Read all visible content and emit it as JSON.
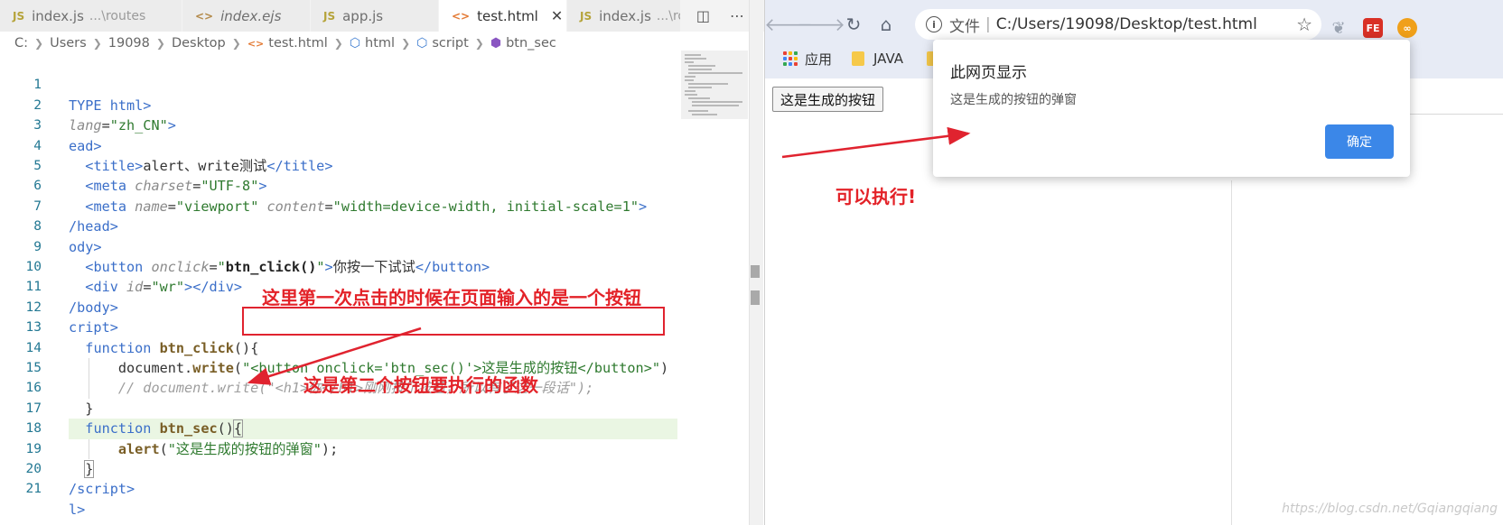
{
  "editor": {
    "tabs": [
      {
        "icon": "JS",
        "name": "index.js",
        "path": "...\\routes",
        "type": "js",
        "italic": false
      },
      {
        "icon": "<>",
        "name": "index.ejs",
        "path": "",
        "type": "ejs",
        "italic": true
      },
      {
        "icon": "JS",
        "name": "app.js",
        "path": "",
        "type": "js",
        "italic": false
      },
      {
        "icon": "<>",
        "name": "test.html",
        "path": "",
        "type": "html",
        "italic": false,
        "active": true,
        "close": "✕"
      },
      {
        "icon": "JS",
        "name": "index.js",
        "path": "...\\rou",
        "type": "js",
        "italic": false
      }
    ],
    "breadcrumb": [
      "C:",
      "Users",
      "19098",
      "Desktop",
      "test.html",
      "html",
      "script",
      "btn_sec"
    ],
    "tab_actions": [
      "◫",
      "⋯"
    ]
  },
  "code_lines": {
    "l1": "TYPE html>",
    "l2_attr": "lang",
    "l2_val": "\"zh_CN\"",
    "l3": "ead>",
    "l4_title_text": "alert、write测试",
    "l5_attr": "charset",
    "l5_val": "\"UTF-8\"",
    "l6_attr1": "name",
    "l6_val1": "\"viewport\"",
    "l6_attr2": "content",
    "l6_val2": "\"width=device-width, initial-scale=1\"",
    "l7": "/head>",
    "l8": "ody>",
    "l9_attr": "onclick",
    "l9_fn": "btn_click()",
    "l9_text": "你按一下试试",
    "l10_attr": "id",
    "l10_val": "\"wr\"",
    "l11": "/body>",
    "l12": "cript>",
    "l13_kw": "function",
    "l13_fn": "btn_click",
    "l14_obj": "document",
    "l14_method": "write",
    "l14_str": "\"<button onclick='btn_sec()'>这是生成的按钮</button>\"",
    "l15_comment": "// document.write(\"<h1>你</h1>刚刚按了按钮，所以有了这一段话\");",
    "l17_kw": "function",
    "l17_fn": "btn_sec",
    "l18_fn": "alert",
    "l18_str": "\"这是生成的按钮的弹窗\"",
    "l20": "/script>",
    "l21": "l>"
  },
  "annotations": {
    "first_click": "这里第一次点击的时候在页面输入的是一个按钮",
    "second_button": "这是第二个按钮要执行的函数",
    "can_execute": "可以执行!"
  },
  "browser": {
    "address_scheme": "文件",
    "address_url": "C:/Users/19098/Desktop/test.html",
    "bookmarks": [
      {
        "label": "应用",
        "type": "apps"
      },
      {
        "label": "JAVA",
        "type": "folder"
      }
    ],
    "page_button": "这是生成的按钮",
    "dialog": {
      "title": "此网页显示",
      "message": "这是生成的按钮的弹窗",
      "ok_label": "确定"
    },
    "extensions": [
      "FE",
      "∞"
    ]
  },
  "watermark": "https://blog.csdn.net/Gqiangqiang",
  "colors": {
    "annotation_red": "#e32228",
    "dialog_button": "#3b87e8",
    "line_highlight": "#eaf6e3"
  }
}
